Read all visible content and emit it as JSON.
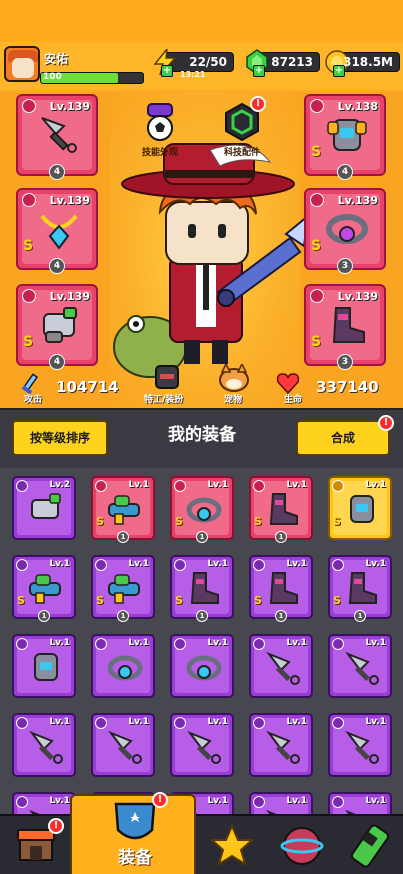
{
  "player": {
    "name": "安佑",
    "level": "100",
    "xp_fraction": 0.75
  },
  "resources": {
    "energy": "22/50",
    "energy_timer": "13:21",
    "gems": "87213",
    "coins": "318.5M"
  },
  "hero": {
    "center_buttons": [
      {
        "label": "技能外观"
      },
      {
        "label": "科技配件",
        "badge": "!"
      }
    ],
    "left_slots": [
      {
        "level": "Lv.139",
        "stars": "4",
        "item": "kunai-icon"
      },
      {
        "level": "Lv.139",
        "stars": "4",
        "item": "necklace-icon"
      },
      {
        "level": "Lv.139",
        "stars": "4",
        "item": "gauntlet-icon"
      }
    ],
    "right_slots": [
      {
        "level": "Lv.138",
        "stars": "4",
        "item": "armor-icon"
      },
      {
        "level": "Lv.139",
        "stars": "3",
        "item": "belt-icon"
      },
      {
        "level": "Lv.139",
        "stars": "3",
        "item": "boots-icon"
      }
    ],
    "attack_label": "攻击",
    "attack_value": "104714",
    "hp_label": "生命",
    "hp_value": "337140",
    "agent_label": "特工/装扮",
    "pet_label": "宠物"
  },
  "toolbar": {
    "sort_label": "按等级排序",
    "title": "我的装备",
    "merge_label": "合成",
    "merge_badge": "!"
  },
  "inventory": [
    {
      "level": "Lv.2",
      "rarity": "purple",
      "item": "gauntlet-icon",
      "s": false,
      "count": ""
    },
    {
      "level": "Lv.1",
      "rarity": "red",
      "item": "gun-icon",
      "s": true,
      "count": "1"
    },
    {
      "level": "Lv.1",
      "rarity": "red",
      "item": "belt-icon",
      "s": true,
      "count": "1"
    },
    {
      "level": "Lv.1",
      "rarity": "red",
      "item": "boots-icon",
      "s": true,
      "count": "1"
    },
    {
      "level": "Lv.1",
      "rarity": "yellow",
      "item": "armor-icon",
      "s": true,
      "count": ""
    },
    {
      "level": "Lv.1",
      "rarity": "purple",
      "item": "gun-icon",
      "s": true,
      "count": "1"
    },
    {
      "level": "Lv.1",
      "rarity": "purple",
      "item": "gun-icon",
      "s": true,
      "count": "1"
    },
    {
      "level": "Lv.1",
      "rarity": "purple",
      "item": "boots-icon",
      "s": true,
      "count": "1"
    },
    {
      "level": "Lv.1",
      "rarity": "purple",
      "item": "boots-icon",
      "s": true,
      "count": "1"
    },
    {
      "level": "Lv.1",
      "rarity": "purple",
      "item": "boots-icon",
      "s": true,
      "count": "1"
    },
    {
      "level": "Lv.1",
      "rarity": "purple",
      "item": "armor-icon",
      "s": false,
      "count": ""
    },
    {
      "level": "Lv.1",
      "rarity": "purple",
      "item": "belt-icon",
      "s": false,
      "count": ""
    },
    {
      "level": "Lv.1",
      "rarity": "purple",
      "item": "belt-icon",
      "s": false,
      "count": ""
    },
    {
      "level": "Lv.1",
      "rarity": "purple",
      "item": "kunai-icon",
      "s": false,
      "count": ""
    },
    {
      "level": "Lv.1",
      "rarity": "purple",
      "item": "kunai-icon",
      "s": false,
      "count": ""
    },
    {
      "level": "Lv.1",
      "rarity": "purple",
      "item": "kunai-icon",
      "s": false,
      "count": ""
    },
    {
      "level": "Lv.1",
      "rarity": "purple",
      "item": "kunai-icon",
      "s": false,
      "count": ""
    },
    {
      "level": "Lv.1",
      "rarity": "purple",
      "item": "kunai-icon",
      "s": false,
      "count": ""
    },
    {
      "level": "Lv.1",
      "rarity": "purple",
      "item": "kunai-icon",
      "s": false,
      "count": ""
    },
    {
      "level": "Lv.1",
      "rarity": "purple",
      "item": "kunai-icon",
      "s": false,
      "count": ""
    },
    {
      "level": "Lv.1",
      "rarity": "purple",
      "item": "kunai-icon",
      "s": false,
      "count": ""
    },
    {
      "level": "Lv.1",
      "rarity": "purple",
      "item": "kunai-icon",
      "s": false,
      "count": ""
    },
    {
      "level": "Lv.1",
      "rarity": "purple",
      "item": "kunai-icon",
      "s": false,
      "count": ""
    },
    {
      "level": "Lv.1",
      "rarity": "purple",
      "item": "kunai-icon",
      "s": false,
      "count": ""
    },
    {
      "level": "Lv.1",
      "rarity": "purple",
      "item": "kunai-icon",
      "s": false,
      "count": ""
    }
  ],
  "nav": {
    "tabs": [
      {
        "name": "shop-tab",
        "icon": "shop-icon",
        "badge": "!"
      },
      {
        "name": "equipment-tab",
        "icon": "equipment-icon",
        "label": "装备",
        "badge": "!",
        "active": true
      },
      {
        "name": "talent-tab",
        "icon": "star-icon"
      },
      {
        "name": "planet-tab",
        "icon": "planet-icon"
      },
      {
        "name": "lab-tab",
        "icon": "capsule-icon"
      }
    ]
  },
  "colors": {
    "hero_bg": "#f9a522",
    "rarity_red": "#e8416a",
    "rarity_purple": "#9a3dd6",
    "rarity_yellow": "#ffc51a",
    "button_yellow": "#ffd21e"
  }
}
